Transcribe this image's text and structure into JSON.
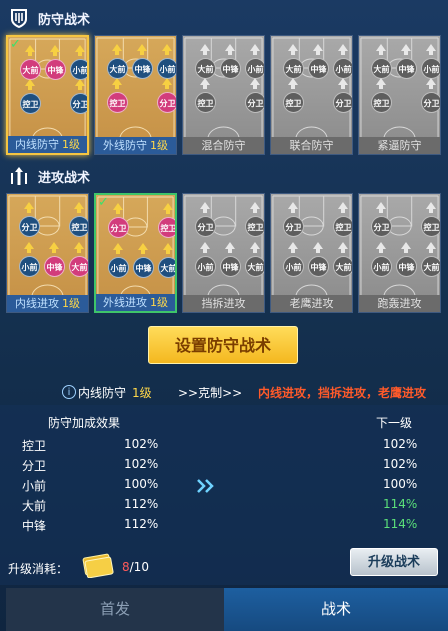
{
  "defense": {
    "title": "防守战术",
    "cards": [
      {
        "label": "内线防守",
        "level": "1级",
        "active": true,
        "selected": true,
        "applied": true,
        "players": [
          {
            "name": "大前",
            "color": "pink"
          },
          {
            "name": "中锋",
            "color": "pink"
          },
          {
            "name": "小前",
            "color": "blue"
          },
          {
            "name": "控卫",
            "color": "blue"
          },
          {
            "name": "分卫",
            "color": "blue"
          }
        ]
      },
      {
        "label": "外线防守",
        "level": "1级",
        "active": true,
        "selected": false,
        "applied": false,
        "players": [
          {
            "name": "大前",
            "color": "blue"
          },
          {
            "name": "中锋",
            "color": "blue"
          },
          {
            "name": "小前",
            "color": "blue"
          },
          {
            "name": "控卫",
            "color": "pink"
          },
          {
            "name": "分卫",
            "color": "pink"
          }
        ]
      },
      {
        "label": "混合防守",
        "level": "",
        "active": false,
        "players": [
          {
            "name": "大前",
            "color": "gray"
          },
          {
            "name": "中锋",
            "color": "gray"
          },
          {
            "name": "小前",
            "color": "gray"
          },
          {
            "name": "控卫",
            "color": "gray"
          },
          {
            "name": "分卫",
            "color": "gray"
          }
        ]
      },
      {
        "label": "联合防守",
        "level": "",
        "active": false,
        "players": [
          {
            "name": "大前",
            "color": "gray"
          },
          {
            "name": "中锋",
            "color": "gray"
          },
          {
            "name": "小前",
            "color": "gray"
          },
          {
            "name": "控卫",
            "color": "gray"
          },
          {
            "name": "分卫",
            "color": "gray"
          }
        ]
      },
      {
        "label": "紧逼防守",
        "level": "",
        "active": false,
        "players": [
          {
            "name": "大前",
            "color": "gray"
          },
          {
            "name": "中锋",
            "color": "gray"
          },
          {
            "name": "小前",
            "color": "gray"
          },
          {
            "name": "控卫",
            "color": "gray"
          },
          {
            "name": "分卫",
            "color": "gray"
          }
        ]
      }
    ]
  },
  "offense": {
    "title": "进攻战术",
    "cards": [
      {
        "label": "内线进攻",
        "level": "1级",
        "active": true,
        "selected": false,
        "applied": false,
        "players": [
          {
            "name": "分卫",
            "color": "blue"
          },
          {
            "name": "控卫",
            "color": "blue"
          },
          {
            "name": "小前",
            "color": "blue"
          },
          {
            "name": "中锋",
            "color": "pink"
          },
          {
            "name": "大前",
            "color": "pink"
          }
        ]
      },
      {
        "label": "外线进攻",
        "level": "1级",
        "active": true,
        "selected": false,
        "applied": true,
        "players": [
          {
            "name": "分卫",
            "color": "pink"
          },
          {
            "name": "控卫",
            "color": "pink"
          },
          {
            "name": "小前",
            "color": "blue"
          },
          {
            "name": "中锋",
            "color": "blue"
          },
          {
            "name": "大前",
            "color": "blue"
          }
        ]
      },
      {
        "label": "挡拆进攻",
        "level": "",
        "active": false,
        "players": [
          {
            "name": "分卫",
            "color": "gray"
          },
          {
            "name": "控卫",
            "color": "gray"
          },
          {
            "name": "小前",
            "color": "gray"
          },
          {
            "name": "中锋",
            "color": "gray"
          },
          {
            "name": "大前",
            "color": "gray"
          }
        ]
      },
      {
        "label": "老鹰进攻",
        "level": "",
        "active": false,
        "players": [
          {
            "name": "分卫",
            "color": "gray"
          },
          {
            "name": "控卫",
            "color": "gray"
          },
          {
            "name": "小前",
            "color": "gray"
          },
          {
            "name": "中锋",
            "color": "gray"
          },
          {
            "name": "大前",
            "color": "gray"
          }
        ]
      },
      {
        "label": "跑轰进攻",
        "level": "",
        "active": false,
        "players": [
          {
            "name": "分卫",
            "color": "gray"
          },
          {
            "name": "控卫",
            "color": "gray"
          },
          {
            "name": "小前",
            "color": "gray"
          },
          {
            "name": "中锋",
            "color": "gray"
          },
          {
            "name": "大前",
            "color": "gray"
          }
        ]
      }
    ]
  },
  "set_button": "设置防守战术",
  "counter": {
    "tactic": "内线防守",
    "level": "1级",
    "arrow_text": ">>克制>>",
    "countered": "内线进攻，挡拆进攻，老鹰进攻"
  },
  "bonus": {
    "title": "防守加成效果",
    "next_title": "下一级",
    "rows": [
      {
        "pos": "控卫",
        "current": "102%",
        "next": "102%",
        "improved": false
      },
      {
        "pos": "分卫",
        "current": "102%",
        "next": "102%",
        "improved": false
      },
      {
        "pos": "小前",
        "current": "100%",
        "next": "100%",
        "improved": false
      },
      {
        "pos": "大前",
        "current": "112%",
        "next": "114%",
        "improved": true
      },
      {
        "pos": "中锋",
        "current": "112%",
        "next": "114%",
        "improved": true
      }
    ]
  },
  "cost": {
    "label": "升级消耗：",
    "have": "8",
    "need": "/10"
  },
  "upgrade_button": "升级战术",
  "tabs": {
    "starters": "首发",
    "tactics": "战术"
  },
  "colors": {
    "accent": "#f5c542",
    "improved": "#5be07a",
    "counter": "#ff5a2a"
  }
}
